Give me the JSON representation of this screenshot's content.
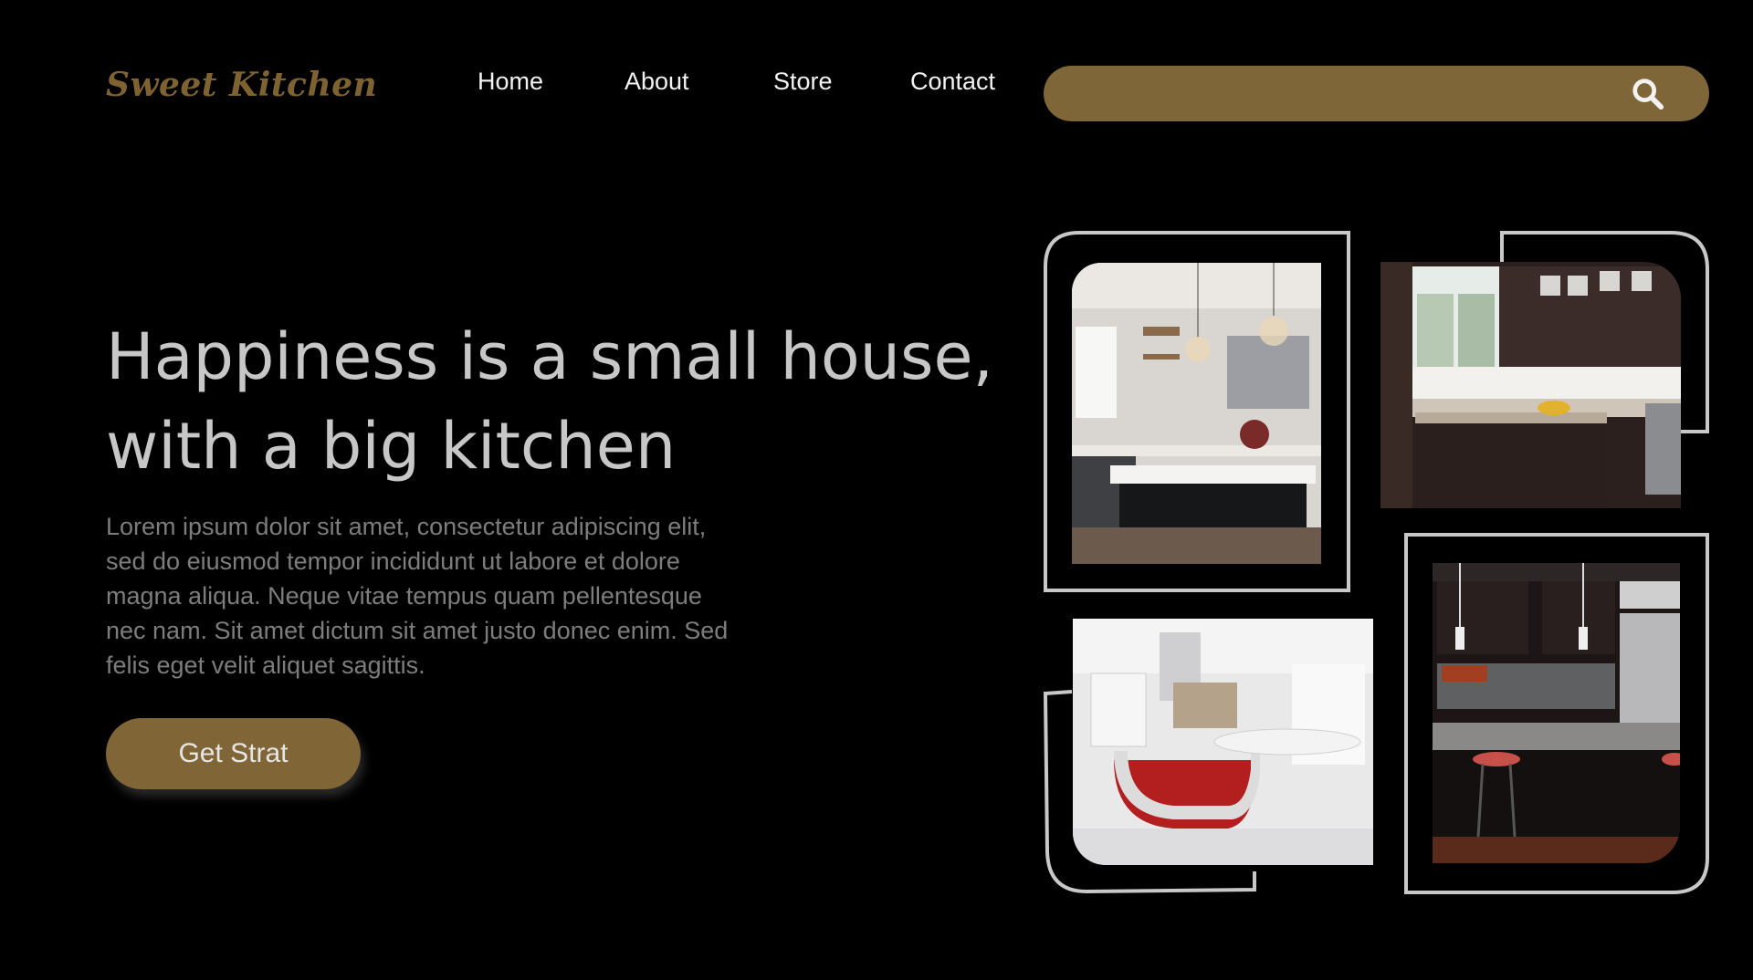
{
  "brand": {
    "name": "Sweet Kitchen"
  },
  "nav": {
    "items": [
      {
        "label": "Home"
      },
      {
        "label": "About"
      },
      {
        "label": "Store"
      },
      {
        "label": "Contact"
      }
    ]
  },
  "search": {
    "value": "",
    "placeholder": "",
    "icon": "search-icon"
  },
  "hero": {
    "headline_line1": "Happiness is a small house,",
    "headline_line2": "with a big kitchen",
    "description": "Lorem ipsum dolor sit amet, consectetur adipiscing elit, sed do eiusmod tempor incididunt ut labore et dolore magna aliqua. Neque vitae tempus quam pellentesque nec nam. Sit amet dictum sit amet justo donec enim. Sed felis eget velit aliquet sagittis.",
    "cta_label": "Get Strat"
  },
  "gallery": {
    "images": [
      {
        "name": "kitchen-white-island-photo"
      },
      {
        "name": "kitchen-dark-cabinets-photo"
      },
      {
        "name": "kitchen-red-curved-island-photo"
      },
      {
        "name": "kitchen-dark-modern-photo"
      }
    ]
  },
  "colors": {
    "background": "#000000",
    "accent": "#7e6639",
    "frame": "#c8c8c8",
    "headline": "#c7c7c7",
    "body_text": "#7d7d7d"
  }
}
